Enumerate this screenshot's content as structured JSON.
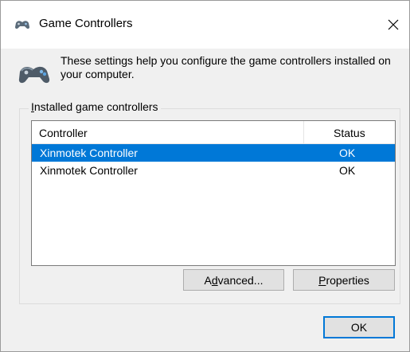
{
  "window": {
    "title": "Game Controllers",
    "title_icon": "gamepad-icon",
    "close_icon": "close-icon"
  },
  "header": {
    "icon": "gamepad-icon",
    "description": "These settings help you configure the game controllers installed on your computer."
  },
  "group": {
    "label_first": "I",
    "label_rest": "nstalled game controllers"
  },
  "list": {
    "columns": {
      "controller": "Controller",
      "status": "Status"
    },
    "rows": [
      {
        "name": "Xinmotek Controller",
        "status": "OK",
        "selected": true
      },
      {
        "name": "Xinmotek Controller",
        "status": "OK",
        "selected": false
      }
    ]
  },
  "buttons": {
    "advanced_pre": "A",
    "advanced_accel": "d",
    "advanced_post": "vanced...",
    "properties_accel": "P",
    "properties_post": "roperties",
    "ok": "OK"
  },
  "colors": {
    "selection": "#0078d7",
    "dialog_bg": "#f0f0f0",
    "default_button_border": "#0078d7"
  }
}
